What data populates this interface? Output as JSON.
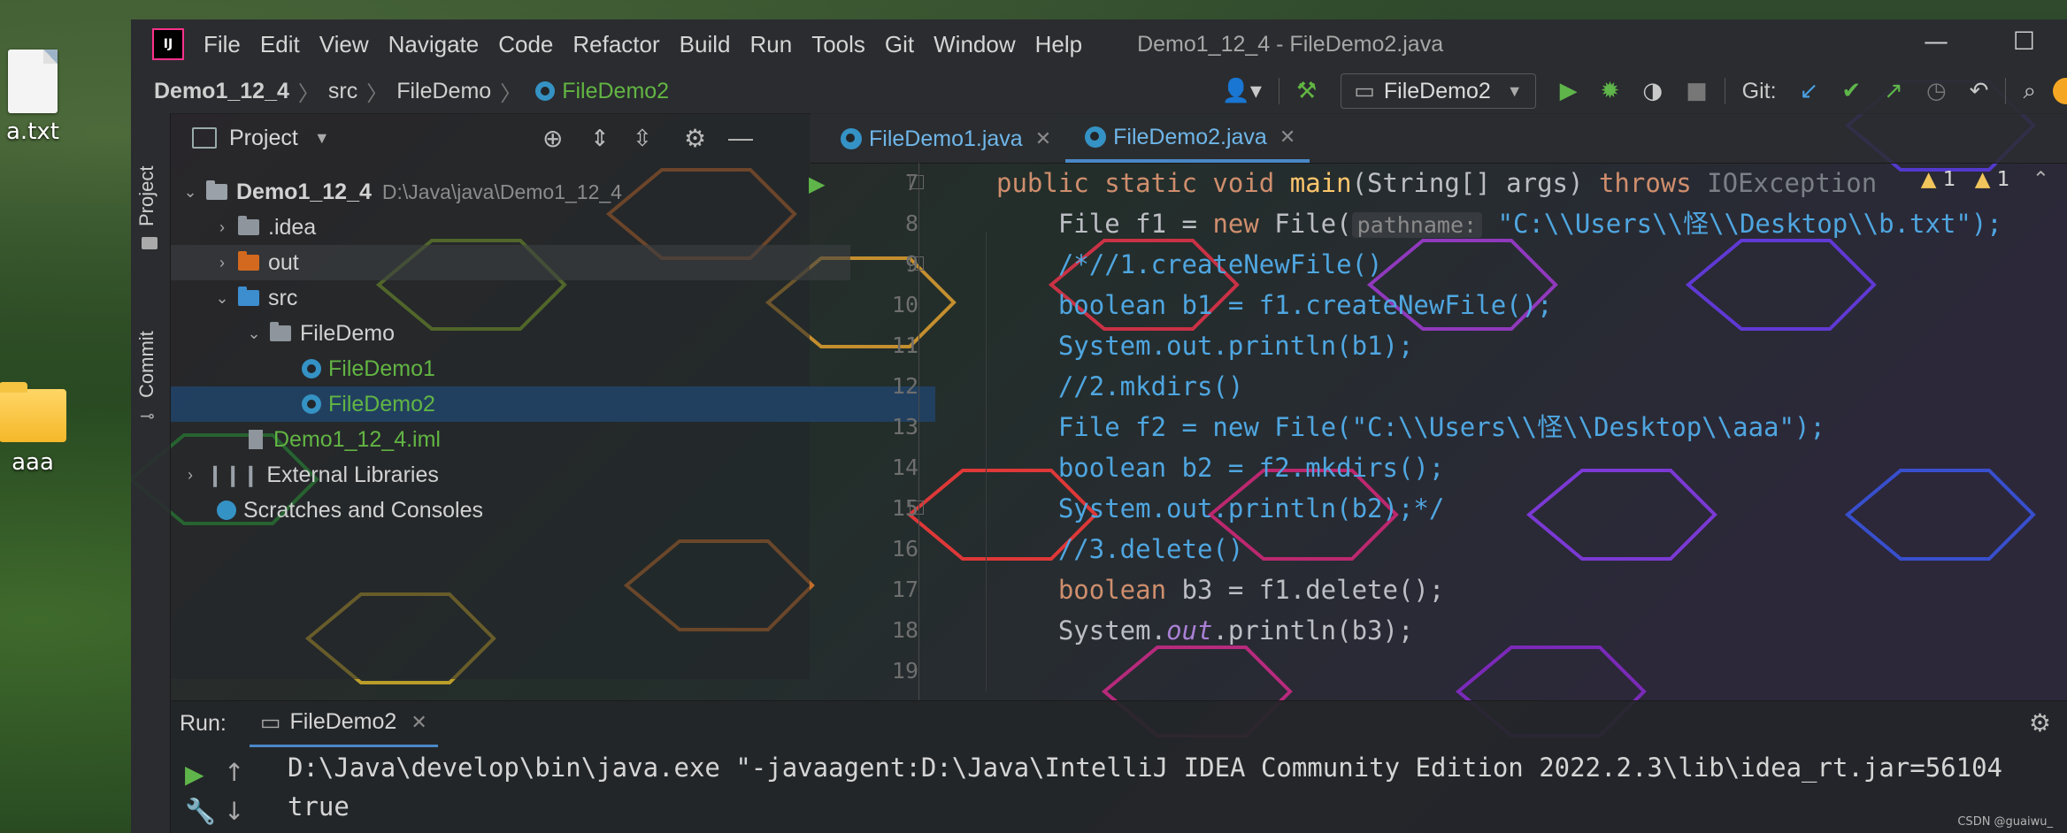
{
  "desktop": {
    "icons": [
      {
        "label": "a.txt",
        "type": "file"
      },
      {
        "label": "aaa",
        "type": "folder"
      }
    ]
  },
  "titlebar": {
    "logo": "IJ",
    "menu": [
      "File",
      "Edit",
      "View",
      "Navigate",
      "Code",
      "Refactor",
      "Build",
      "Run",
      "Tools",
      "Git",
      "Window",
      "Help"
    ],
    "window_title": "Demo1_12_4 - FileDemo2.java"
  },
  "navbar": {
    "breadcrumbs": [
      "Demo1_12_4",
      "src",
      "FileDemo",
      "FileDemo2"
    ],
    "run_config": "FileDemo2",
    "git_label": "Git:"
  },
  "left_strip": {
    "project_label": "Project",
    "commit_label": "Commit"
  },
  "project": {
    "header": "Project",
    "tree": [
      {
        "label": "Demo1_12_4",
        "path": "D:\\Java\\java\\Demo1_12_4"
      },
      {
        "label": ".idea"
      },
      {
        "label": "out"
      },
      {
        "label": "src"
      },
      {
        "label": "FileDemo"
      },
      {
        "label": "FileDemo1"
      },
      {
        "label": "FileDemo2"
      },
      {
        "label": "Demo1_12_4.iml"
      },
      {
        "label": "External Libraries"
      },
      {
        "label": "Scratches and Consoles"
      }
    ]
  },
  "editor": {
    "tabs": [
      "FileDemo1.java",
      "FileDemo2.java"
    ],
    "active_tab": "FileDemo2.java",
    "line_numbers": [
      "7",
      "8",
      "9",
      "10",
      "11",
      "12",
      "13",
      "14",
      "15",
      "16",
      "17",
      "18",
      "19"
    ],
    "code": {
      "l7_a": "public static void ",
      "l7_fn": "main",
      "l7_b": "(String[] args) ",
      "l7_kw": "throws",
      "l7_c": " IOException",
      "l8_a": "    File f1 = ",
      "l8_kw": "new",
      "l8_b": " File(",
      "l8_hint": "pathname:",
      "l8_str": " \"C:\\\\Users\\\\怪\\\\Desktop\\\\b.txt\");",
      "l9": "    /*//1.createNewFile()",
      "l10": "    boolean b1 = f1.createNewFile();",
      "l11": "    System.out.println(b1);",
      "l12": "    //2.mkdirs()",
      "l13": "    File f2 = new File(\"C:\\\\Users\\\\怪\\\\Desktop\\\\aaa\");",
      "l14": "    boolean b2 = f2.mkdirs();",
      "l15": "    System.out.println(b2);*/",
      "l16": "    //3.delete()",
      "l17_kw": "    boolean",
      "l17_b": " b3 = f1.delete();",
      "l18_a": "    System.",
      "l18_fld": "out",
      "l18_b": ".println(b3);"
    },
    "warnings": {
      "errors": "1",
      "warnings": "1"
    }
  },
  "run": {
    "label": "Run:",
    "tab": "FileDemo2",
    "console": [
      "D:\\Java\\develop\\bin\\java.exe \"-javaagent:D:\\Java\\IntelliJ IDEA Community Edition 2022.2.3\\lib\\idea_rt.jar=56104",
      "true"
    ]
  },
  "watermark": "CSDN @guaiwu_"
}
